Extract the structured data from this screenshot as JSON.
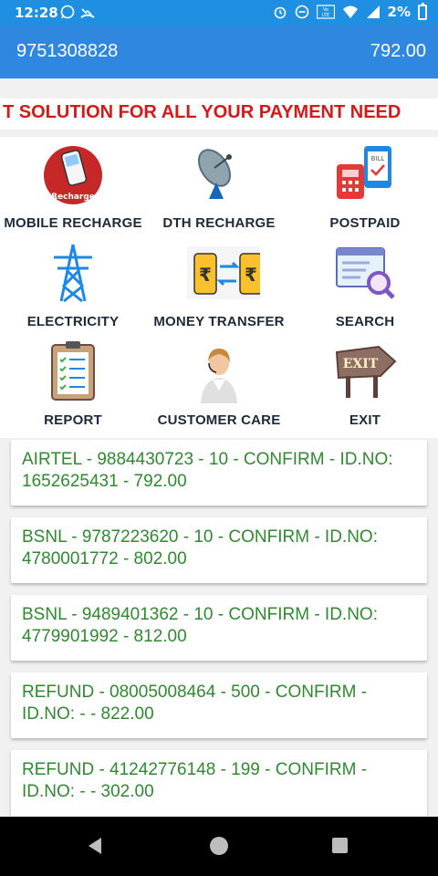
{
  "statusbar": {
    "time": "12:28",
    "battery": "2%",
    "icons_left": [
      "whatsapp-icon",
      "missed-call-icon"
    ],
    "icons_right": [
      "alarm-icon",
      "do-not-disturb-icon",
      "volte-icon",
      "wifi-icon",
      "signal-icon",
      "battery-icon"
    ]
  },
  "header": {
    "phone": "9751308828",
    "balance": "792.00"
  },
  "marquee": {
    "text": "T SOLUTION FOR ALL YOUR PAYMENT NEED"
  },
  "menu": {
    "items": [
      {
        "label": "MOBILE RECHARGE",
        "icon": "mobile-recharge-icon",
        "badge": "Recharge"
      },
      {
        "label": "DTH RECHARGE",
        "icon": "satellite-dish-icon"
      },
      {
        "label": "POSTPAID",
        "icon": "postpaid-bill-icon",
        "badge": "BILL"
      },
      {
        "label": "ELECTRICITY",
        "icon": "power-tower-icon"
      },
      {
        "label": "MONEY TRANSFER",
        "icon": "money-transfer-icon",
        "badge": "₹"
      },
      {
        "label": "SEARCH",
        "icon": "search-form-icon"
      },
      {
        "label": "REPORT",
        "icon": "clipboard-report-icon"
      },
      {
        "label": "CUSTOMER CARE",
        "icon": "customer-care-agent-icon"
      },
      {
        "label": "EXIT",
        "icon": "exit-sign-icon",
        "badge": "EXIT"
      }
    ]
  },
  "transactions": [
    {
      "text": "AIRTEL - 9884430723 - 10 - CONFIRM - ID.NO: 1652625431 - 792.00"
    },
    {
      "text": "BSNL - 9787223620 - 10 - CONFIRM - ID.NO: 4780001772 - 802.00"
    },
    {
      "text": "BSNL - 9489401362 - 10 - CONFIRM - ID.NO: 4779901992 - 812.00"
    },
    {
      "text": "REFUND - 08005008464 - 500 - CONFIRM - ID.NO: - - 822.00"
    },
    {
      "text": "REFUND - 41242776148 - 199 - CONFIRM - ID.NO: - - 302.00"
    }
  ],
  "colors": {
    "appbar": "#2f87e0",
    "statusbar": "#1e8fe1",
    "marquee_text": "#d41919",
    "transaction_text": "#2f8a2f"
  }
}
